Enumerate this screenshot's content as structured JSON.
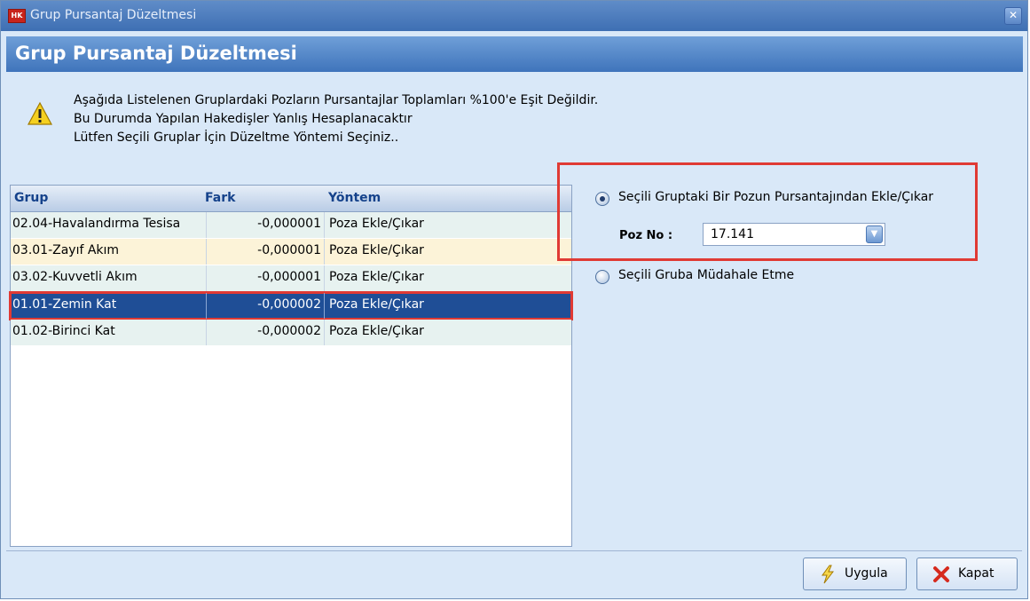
{
  "window": {
    "title": "Grup Pursantaj Düzeltmesi",
    "app_icon_text": "HK"
  },
  "header": {
    "title": "Grup Pursantaj Düzeltmesi"
  },
  "warning": {
    "lines": [
      "Aşağıda Listelenen Gruplardaki Pozların Pursantajlar Toplamları  %100'e Eşit Değildir.",
      "Bu Durumda Yapılan Hakedişler Yanlış Hesaplanacaktır",
      "Lütfen Seçili Gruplar İçin Düzeltme Yöntemi Seçiniz.."
    ]
  },
  "table": {
    "columns": [
      "Grup",
      "Fark",
      "Yöntem"
    ],
    "rows": [
      {
        "grup": "02.04-Havalandırma Tesisa",
        "fark": "-0,000001",
        "yontem": "Poza Ekle/Çıkar"
      },
      {
        "grup": "03.01-Zayıf Akım",
        "fark": "-0,000001",
        "yontem": "Poza Ekle/Çıkar"
      },
      {
        "grup": "03.02-Kuvvetli Akım",
        "fark": "-0,000001",
        "yontem": "Poza Ekle/Çıkar"
      },
      {
        "grup": "01.01-Zemin Kat",
        "fark": "-0,000002",
        "yontem": "Poza Ekle/Çıkar"
      },
      {
        "grup": "01.02-Birinci Kat",
        "fark": "-0,000002",
        "yontem": "Poza Ekle/Çıkar"
      }
    ],
    "selected_row": 3
  },
  "options": {
    "option1_label": "Seçili Gruptaki Bir Pozun Pursantajından Ekle/Çıkar",
    "option1_selected": true,
    "poz_label": "Poz No :",
    "poz_value": "17.141",
    "option2_label": "Seçili Gruba Müdahale Etme",
    "option2_selected": false
  },
  "buttons": {
    "apply_label": "Uygula",
    "close_label": "Kapat"
  },
  "colors": {
    "highlight": "#e03a34",
    "selection": "#1f4e96"
  }
}
